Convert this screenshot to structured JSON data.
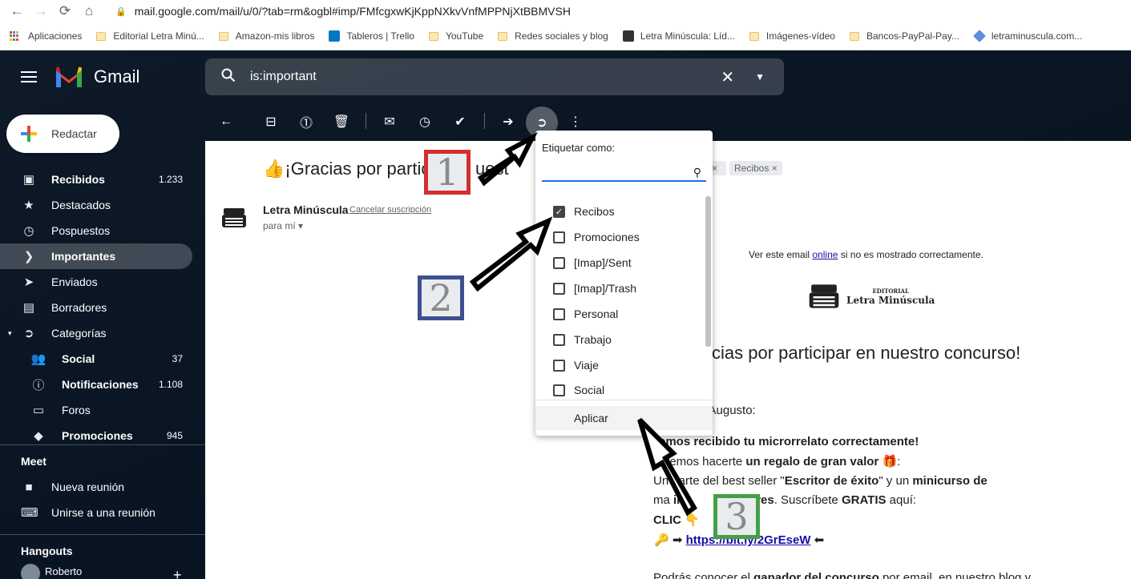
{
  "browser": {
    "url": "mail.google.com/mail/u/0/?tab=rm&ogbl#imp/FMfcgxwKjKppNXkvVnfMPPNjXtBBMVSH",
    "bookmarks": [
      "Aplicaciones",
      "Editorial Letra Minú...",
      "Amazon-mis libros",
      "Tableros | Trello",
      "YouTube",
      "Redes sociales y blog",
      "Letra Minúscula: Líd...",
      "Imágenes-vídeo",
      "Bancos-PayPal-Pay...",
      "letraminuscula.com..."
    ]
  },
  "gmail": {
    "logo": "Gmail",
    "search": {
      "query": "is:important"
    },
    "compose": "Redactar",
    "nav": [
      {
        "label": "Recibidos",
        "count": "1.233",
        "icon": "inbox-icon",
        "bold": true
      },
      {
        "label": "Destacados",
        "count": "",
        "icon": "star-icon"
      },
      {
        "label": "Pospuestos",
        "count": "",
        "icon": "clock-icon"
      },
      {
        "label": "Importantes",
        "count": "",
        "icon": "important-icon",
        "bold": true,
        "active": true
      },
      {
        "label": "Enviados",
        "count": "",
        "icon": "send-icon"
      },
      {
        "label": "Borradores",
        "count": "",
        "icon": "draft-icon"
      },
      {
        "label": "Categorías",
        "count": "",
        "icon": "label-icon"
      },
      {
        "label": "Social",
        "count": "37",
        "icon": "people-icon",
        "bold": true,
        "sub": true
      },
      {
        "label": "Notificaciones",
        "count": "1.108",
        "icon": "info-icon",
        "bold": true,
        "sub": true
      },
      {
        "label": "Foros",
        "count": "",
        "icon": "forum-icon",
        "sub": true
      },
      {
        "label": "Promociones",
        "count": "945",
        "icon": "tag-icon",
        "bold": true,
        "sub": true
      }
    ],
    "meet": {
      "heading": "Meet",
      "items": [
        "Nueva reunión",
        "Unirse a una reunión"
      ]
    },
    "hangouts": {
      "heading": "Hangouts",
      "user": "Roberto"
    }
  },
  "email": {
    "subject": "¡Gracias por partic",
    "subject_tail": "uest",
    "tags": [
      "Recibos"
    ],
    "sender": "Letra Minúscula",
    "unsubscribe": "Cancelar suscripción",
    "to": "para mí",
    "view_online_pre": "Ver este email",
    "view_online_link": "online",
    "view_online_post": "si no es mostrado correctamente.",
    "brand_small": "EDITORIAL",
    "brand_big": "Letra Minúscula",
    "headline": "cias por participar en nuestro concurso!",
    "greeting": "rtoAugusto:",
    "line1": "emos recibido tu microrrelato correctamente!",
    "line2_pre": "eremos hacerte",
    "line2_bold": "un regalo de gran valor",
    "line3_pre": "Un",
    "line3_mid": "parte del best seller \"",
    "line3_b1": "Escritor de éxito",
    "line3_mid2": "\" y un",
    "line3_b2": "minicurso de",
    "line4_pre": "ma",
    "line4_b": "ing",
    "line4_b2": "critores",
    "line4_post": ". Suscríbete",
    "line4_b3": "GRATIS",
    "line4_end": "aquí:",
    "line5": "CLIC",
    "link": "https://bit.ly/2GrEseW",
    "footer_pre": "Podrás conocer el",
    "footer_bold": "ganador del concurso",
    "footer_post": "por email, en nuestro blog y"
  },
  "label_menu": {
    "title": "Etiquetar como:",
    "options": [
      {
        "label": "Recibos",
        "checked": true
      },
      {
        "label": "Promociones",
        "checked": false
      },
      {
        "label": "[Imap]/Sent",
        "checked": false
      },
      {
        "label": "[Imap]/Trash",
        "checked": false
      },
      {
        "label": "Personal",
        "checked": false
      },
      {
        "label": "Trabajo",
        "checked": false
      },
      {
        "label": "Viaje",
        "checked": false
      },
      {
        "label": "Social",
        "checked": false
      }
    ],
    "apply": "Aplicar"
  },
  "annotations": [
    "1",
    "2",
    "3"
  ],
  "colors": {
    "annotation1": "#d32f2f",
    "annotation2": "#3f4f8f",
    "annotation3": "#43a047",
    "accent": "#1a73e8"
  }
}
